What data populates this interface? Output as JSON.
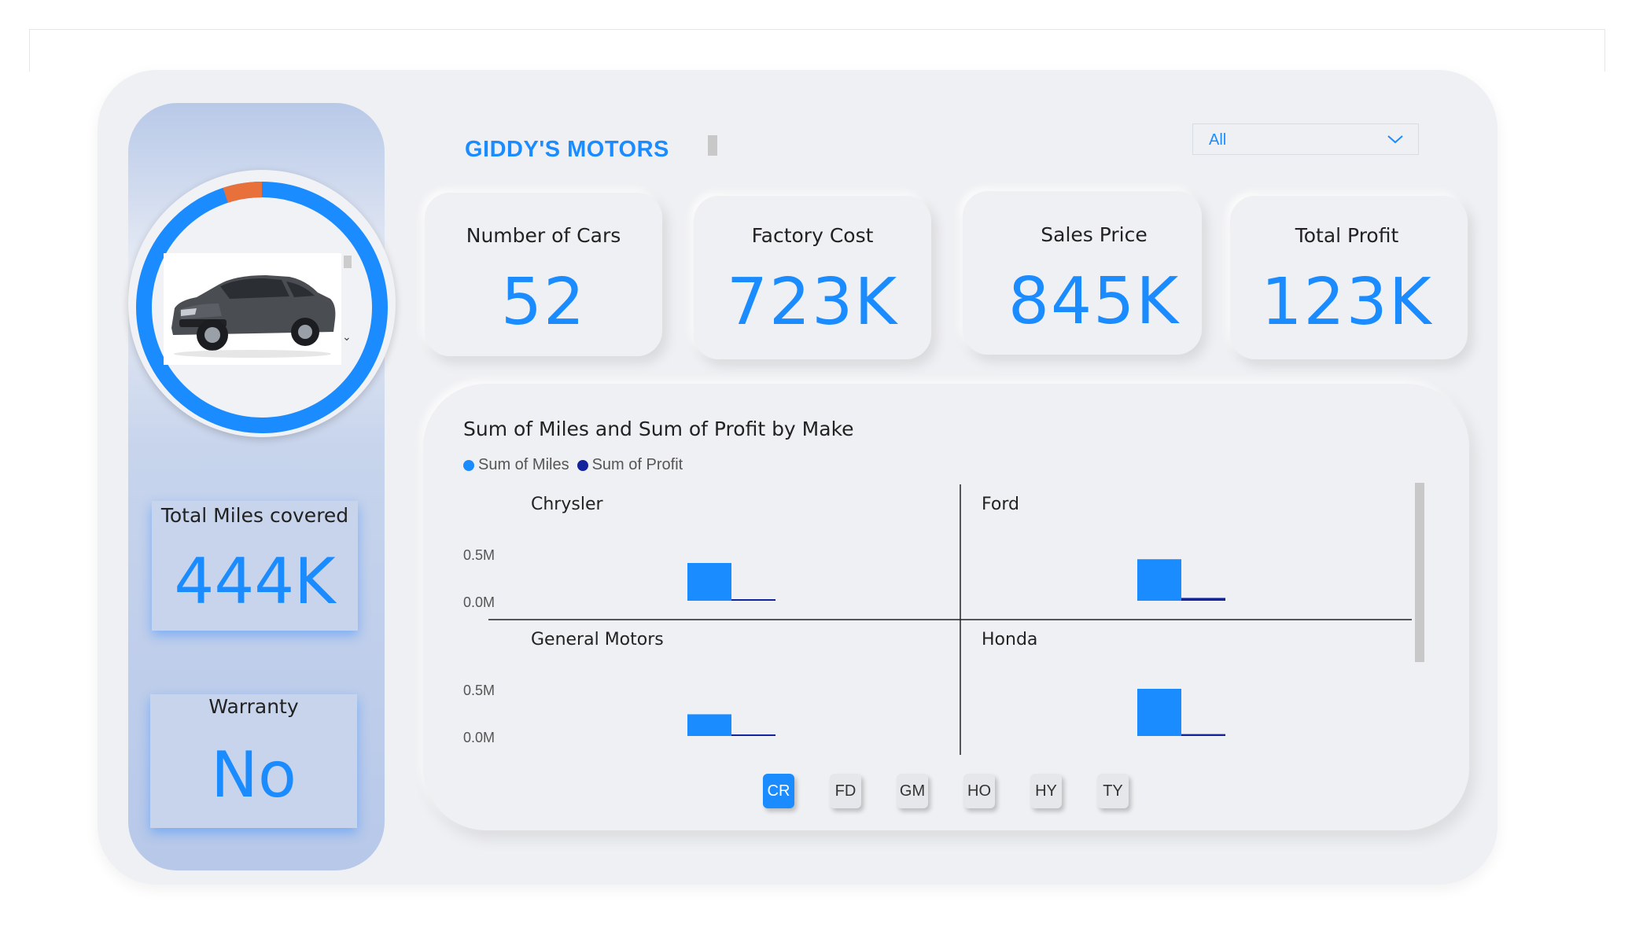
{
  "header": {
    "brand": "GIDDY'S MOTORS",
    "filter_value": "All"
  },
  "left_panel": {
    "miles_title": "Total Miles covered",
    "miles_value": "444K",
    "warranty_title": "Warranty",
    "warranty_value": "No",
    "donut_highlight_fraction": 0.05
  },
  "kpis": [
    {
      "title": "Number of Cars",
      "value": "52"
    },
    {
      "title": "Factory Cost",
      "value": "723K"
    },
    {
      "title": "Sales Price",
      "value": "845K"
    },
    {
      "title": "Total Profit",
      "value": "123K"
    }
  ],
  "chart_data": {
    "type": "bar",
    "title": "Sum of Miles and Sum of Profit by Make",
    "series_names": [
      "Sum of Miles",
      "Sum of Profit"
    ],
    "series_colors": [
      "#1a8cff",
      "#12239e"
    ],
    "y_ticks": [
      "0.5M",
      "0.0M"
    ],
    "ylim": [
      0,
      0.5
    ],
    "panels": [
      {
        "make": "Chrysler",
        "miles": 0.4,
        "profit": 0.01
      },
      {
        "make": "Ford",
        "miles": 0.44,
        "profit": 0.03
      },
      {
        "make": "General Motors",
        "miles": 0.23,
        "profit": 0.01
      },
      {
        "make": "Honda",
        "miles": 0.5,
        "profit": 0.02
      }
    ]
  },
  "make_buttons": [
    {
      "label": "CR",
      "active": true
    },
    {
      "label": "FD",
      "active": false
    },
    {
      "label": "GM",
      "active": false
    },
    {
      "label": "HO",
      "active": false
    },
    {
      "label": "HY",
      "active": false
    },
    {
      "label": "TY",
      "active": false
    }
  ],
  "colors": {
    "accent": "#1a8cff",
    "profit": "#12239e",
    "donut_highlight": "#e8703a"
  }
}
